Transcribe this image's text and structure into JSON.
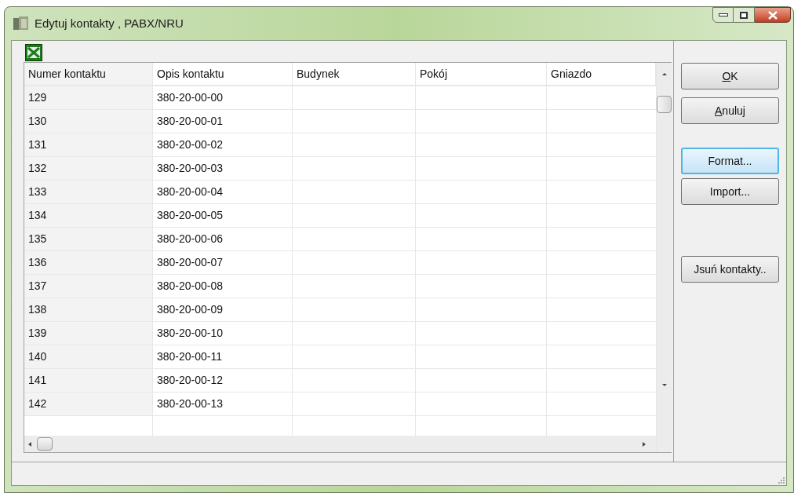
{
  "window": {
    "title": "Edytuj kontakty , PABX/NRU"
  },
  "table": {
    "columns": [
      "Numer kontaktu",
      "Opis kontaktu",
      "Budynek",
      "Pokój",
      "Gniazdo"
    ],
    "rows": [
      [
        "129",
        "380-20-00-00"
      ],
      [
        "130",
        "380-20-00-01"
      ],
      [
        "131",
        "380-20-00-02"
      ],
      [
        "132",
        "380-20-00-03"
      ],
      [
        "133",
        "380-20-00-04"
      ],
      [
        "134",
        "380-20-00-05"
      ],
      [
        "135",
        "380-20-00-06"
      ],
      [
        "136",
        "380-20-00-07"
      ],
      [
        "137",
        "380-20-00-08"
      ],
      [
        "138",
        "380-20-00-09"
      ],
      [
        "139",
        "380-20-00-10"
      ],
      [
        "140",
        "380-20-00-11"
      ],
      [
        "141",
        "380-20-00-12"
      ],
      [
        "142",
        "380-20-00-13"
      ]
    ]
  },
  "buttons": [
    {
      "label": "OK",
      "access_key_underlined": true,
      "focused": false
    },
    {
      "label": "Anuluj",
      "access_key_underlined": true,
      "focused": false
    },
    {
      "label": "Format...",
      "focused": true
    },
    {
      "label": "Import...",
      "focused": false
    },
    {
      "label": "Jsuń kontakty..",
      "focused": false
    }
  ]
}
